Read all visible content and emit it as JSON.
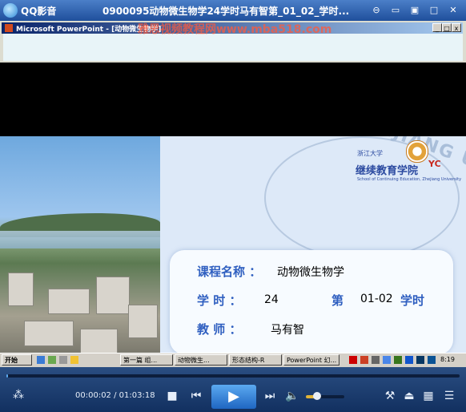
{
  "window": {
    "app_name": "QQ影音",
    "title": "0900095动物微生物学24学时马有智第_01_02_学时...",
    "buttons": {
      "pin": "⊖",
      "minimize": "▭",
      "restore": "▣",
      "maximize": "□",
      "close": "✕"
    }
  },
  "ppt_window": {
    "title": "Microsoft PowerPoint - [动物微生物学]",
    "watermark": "雅思视频教程网www.mba518.com",
    "buttons": {
      "minimize": "_",
      "restore": "□",
      "close": "x"
    }
  },
  "slide": {
    "school_name_small": "浙江大学",
    "school_name": "继续教育学院",
    "school_badge": "YC",
    "school_english": "School of Continuing Education, Zhejiang University",
    "seal_text": "HEJIANG UNIVER",
    "course_label": "课程名称 ：",
    "course_value": "动物微生物学",
    "hours_label": "学   时 ：",
    "hours_value": "24",
    "lesson_prefix": "第",
    "lesson_value": "01-02",
    "lesson_suffix": "学时",
    "teacher_label": "教   师 ：",
    "teacher_value": "马有智"
  },
  "taskbar": {
    "start": "开始",
    "items": [
      "第一篇 组...",
      "动物微生...",
      "形态结构-R",
      "PowerPoint 幻..."
    ],
    "clock": "8:19"
  },
  "player": {
    "current_time": "00:00:02",
    "total_time": "01:03:18",
    "time_separator": "/",
    "progress": 0.0005,
    "volume": 0.3,
    "icons": {
      "footprint": "footprint-icon",
      "stop": "stop-icon",
      "prev": "previous-icon",
      "play": "play-icon",
      "next": "next-icon",
      "volume": "volume-icon",
      "settings": "wrench-icon",
      "eject": "eject-icon",
      "playlist": "playlist-icon",
      "menu": "menu-icon"
    },
    "accent_color": "#e0b338"
  }
}
